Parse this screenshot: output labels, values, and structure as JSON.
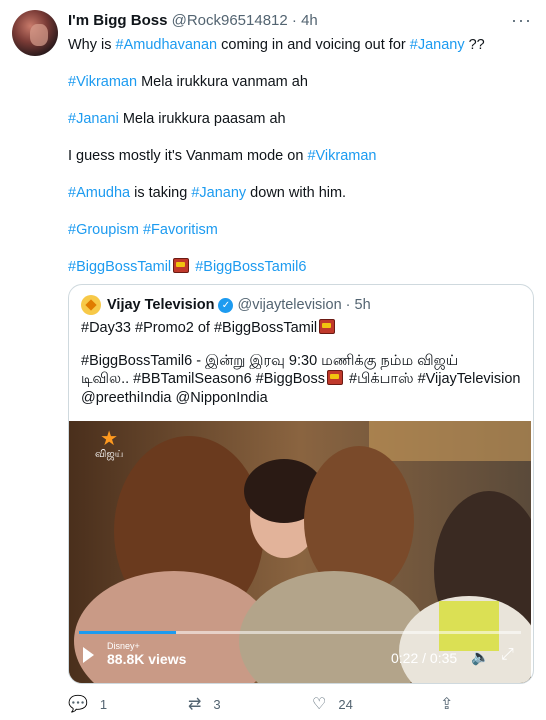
{
  "author": {
    "name": "I'm Bigg Boss",
    "handle": "@Rock96514812",
    "time": "4h",
    "avatar_icon": "avatar-image"
  },
  "more_label": "···",
  "tweet": {
    "p1": {
      "prefix": "Why is ",
      "tag1": "#Amudhavanan",
      "mid": " coming in and voicing out for ",
      "tag2": "#Janany",
      "suffix": " ??"
    },
    "p2": {
      "tag": "#Vikraman",
      "text": " Mela irukkura vanmam ah"
    },
    "p3": {
      "tag": "#Janani",
      "text": " Mela irukkura paasam ah"
    },
    "p4": {
      "text": "I guess mostly it's Vanmam mode on ",
      "tag": "#Vikraman"
    },
    "p5": {
      "tag1": "#Amudha",
      "mid": " is taking ",
      "tag2": "#Janany",
      "suffix": " down with him."
    },
    "p6": {
      "tag1": "#Groupism",
      "tag2": "#Favoritism"
    },
    "p7": {
      "tag1": "#BiggBossTamil",
      "tag2": "#BiggBossTamil6"
    }
  },
  "quote": {
    "name": "Vijay Television",
    "handle": "@vijaytelevision",
    "time": "5h",
    "line1": "#Day33 #Promo2 of #BiggBossTamil",
    "line2": "#BiggBossTamil6 - இன்று இரவு 9:30 மணிக்கு நம்ம விஜய்",
    "line3a": "டிவில.. #BBTamilSeason6 #BiggBoss",
    "line3b": " #பிக்பாஸ் #VijayTelevision",
    "line4": "@preethiIndia  @NipponIndia",
    "video": {
      "channel_logo": "விஜய்",
      "brand": "Disney+",
      "views": "88.8K views",
      "time": "0:22 / 0:35",
      "progress": 0.22
    }
  },
  "actions": {
    "reply_count": "1",
    "retweet_count": "3",
    "like_count": "24"
  },
  "colors": {
    "link": "#1d9bf0",
    "muted": "#536471",
    "border": "#cfd9de"
  }
}
